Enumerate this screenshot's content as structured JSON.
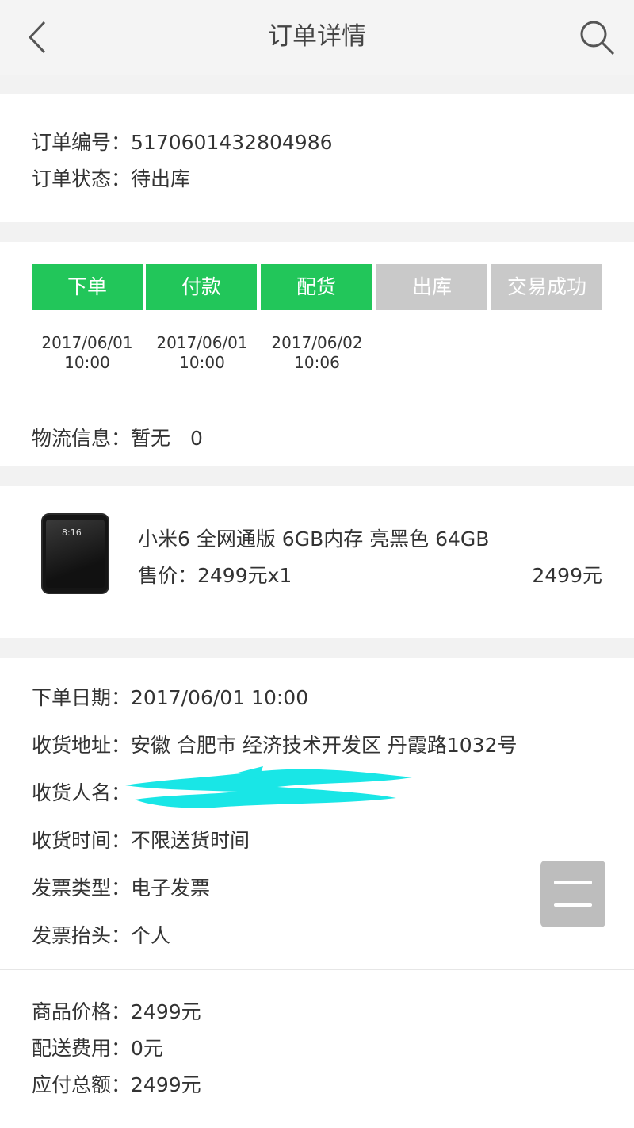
{
  "header": {
    "title": "订单详情"
  },
  "order": {
    "number_label": "订单编号：",
    "number": "5170601432804986",
    "status_label": "订单状态：",
    "status": "待出库"
  },
  "steps": [
    {
      "label": "下单",
      "date": "2017/06/01",
      "time": "10:00",
      "done": true
    },
    {
      "label": "付款",
      "date": "2017/06/01",
      "time": "10:00",
      "done": true
    },
    {
      "label": "配货",
      "date": "2017/06/02",
      "time": "10:06",
      "done": true
    },
    {
      "label": "出库",
      "date": "",
      "time": "",
      "done": false
    },
    {
      "label": "交易成功",
      "date": "",
      "time": "",
      "done": false
    }
  ],
  "logistics": {
    "label": "物流信息：",
    "value": "暂无　0"
  },
  "product": {
    "name": "小米6 全网通版 6GB内存 亮黑色 64GB",
    "price_line": "售价：2499元x1",
    "subtotal": "2499元",
    "image_clock": "8:16"
  },
  "details": {
    "order_date_label": "下单日期：",
    "order_date": "2017/06/01 10:00",
    "address_label": "收货地址：",
    "address": "安徽 合肥市 经济技术开发区 丹霞路1032号",
    "receiver_label": "收货人名：",
    "delivery_time_label": "收货时间：",
    "delivery_time": "不限送货时间",
    "invoice_type_label": "发票类型：",
    "invoice_type": "电子发票",
    "invoice_title_label": "发票抬头：",
    "invoice_title": "个人"
  },
  "totals": {
    "goods_price_label": "商品价格：",
    "goods_price": "2499元",
    "shipping_label": "配送费用：",
    "shipping": "0元",
    "total_label": "应付总额：",
    "total": "2499元"
  },
  "colors": {
    "accent": "#22c65a",
    "pending": "#c9c9c9",
    "redaction": "#19e6e6"
  },
  "icons": {
    "back": "chevron-left-icon",
    "search": "search-icon",
    "menu": "menu-icon"
  }
}
